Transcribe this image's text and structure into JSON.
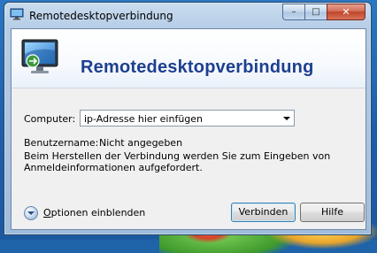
{
  "window": {
    "title": "Remotedesktopverbindung",
    "minimize_label": "–",
    "maximize_label": "□",
    "close_label": "✕"
  },
  "banner": {
    "title": "Remotedesktopverbindung"
  },
  "form": {
    "computer_label": "Computer:",
    "computer_value": "ip-Adresse hier einfügen",
    "username_label": "Benutzername:",
    "username_value": "Nicht angegeben",
    "info_line1": "Beim Herstellen der Verbindung werden Sie zum Eingeben von",
    "info_line2": "Anmeldeinformationen aufgefordert."
  },
  "footer": {
    "options_label_accel": "O",
    "options_label_rest": "ptionen einblenden",
    "connect_label": "Verbinden",
    "help_label": "Hilfe"
  },
  "icons": {
    "window_icon": "remote-desktop-icon",
    "banner_icon": "remote-desktop-monitor-icon",
    "options_icon": "chevron-down-circle-icon",
    "dropdown_icon": "dropdown-arrow-icon"
  },
  "colors": {
    "banner_title": "#1d3f8f",
    "desktop": "#1f63a8",
    "close_button": "#c0452b"
  }
}
